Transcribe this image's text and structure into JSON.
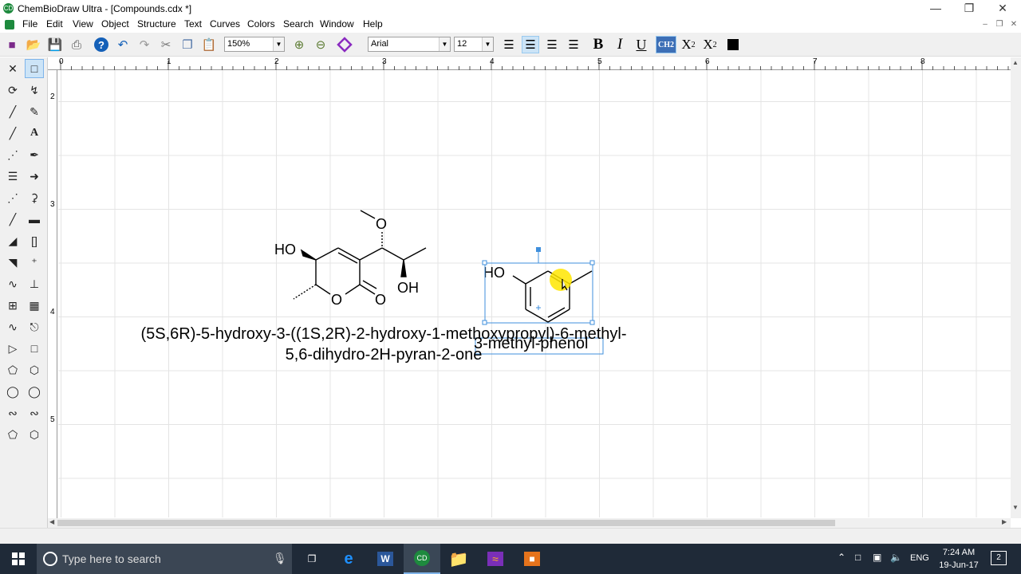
{
  "window": {
    "title": "ChemBioDraw Ultra - [Compounds.cdx *]",
    "app_icon": "CD"
  },
  "menu": [
    "File",
    "Edit",
    "View",
    "Object",
    "Structure",
    "Text",
    "Curves",
    "Colors",
    "Search",
    "Window",
    "Help"
  ],
  "toolbar": {
    "zoom": "150%",
    "font": "Arial",
    "font_size": "12",
    "bold": "B",
    "italic": "I",
    "underline": "U",
    "chem_style": "CH2",
    "subscript_base": "X",
    "subscript_mark": "2",
    "superscript_base": "X",
    "superscript_mark": "2"
  },
  "ruler": {
    "h_labels": [
      "0",
      "1",
      "2",
      "3",
      "4",
      "5",
      "6",
      "7",
      "8"
    ],
    "v_labels": [
      "2",
      "3",
      "4",
      "5"
    ]
  },
  "canvas": {
    "compound1": {
      "label_top": "HO",
      "label_oh": "OH",
      "atom_o_methoxy": "O",
      "atom_o_ring": "O",
      "atom_o_carbonyl": "O",
      "name_line1": "(5S,6R)-5-hydroxy-3-((1S,2R)-2-hydroxy-1-methoxypropyl)-6-methyl-",
      "name_line2": "5,6-dihydro-2H-pyran-2-one"
    },
    "compound2": {
      "label_ho": "HO",
      "name": "3-methyl-phenol"
    }
  },
  "taskbar": {
    "search_placeholder": "Type here to search",
    "language": "ENG",
    "time": "7:24 AM",
    "date": "19-Jun-17",
    "notifications": "2"
  },
  "colors": {
    "accent": "#0078d7",
    "taskbar": "#1f2a38",
    "selection": "#3f8fdc",
    "highlight": "#ffe600"
  }
}
